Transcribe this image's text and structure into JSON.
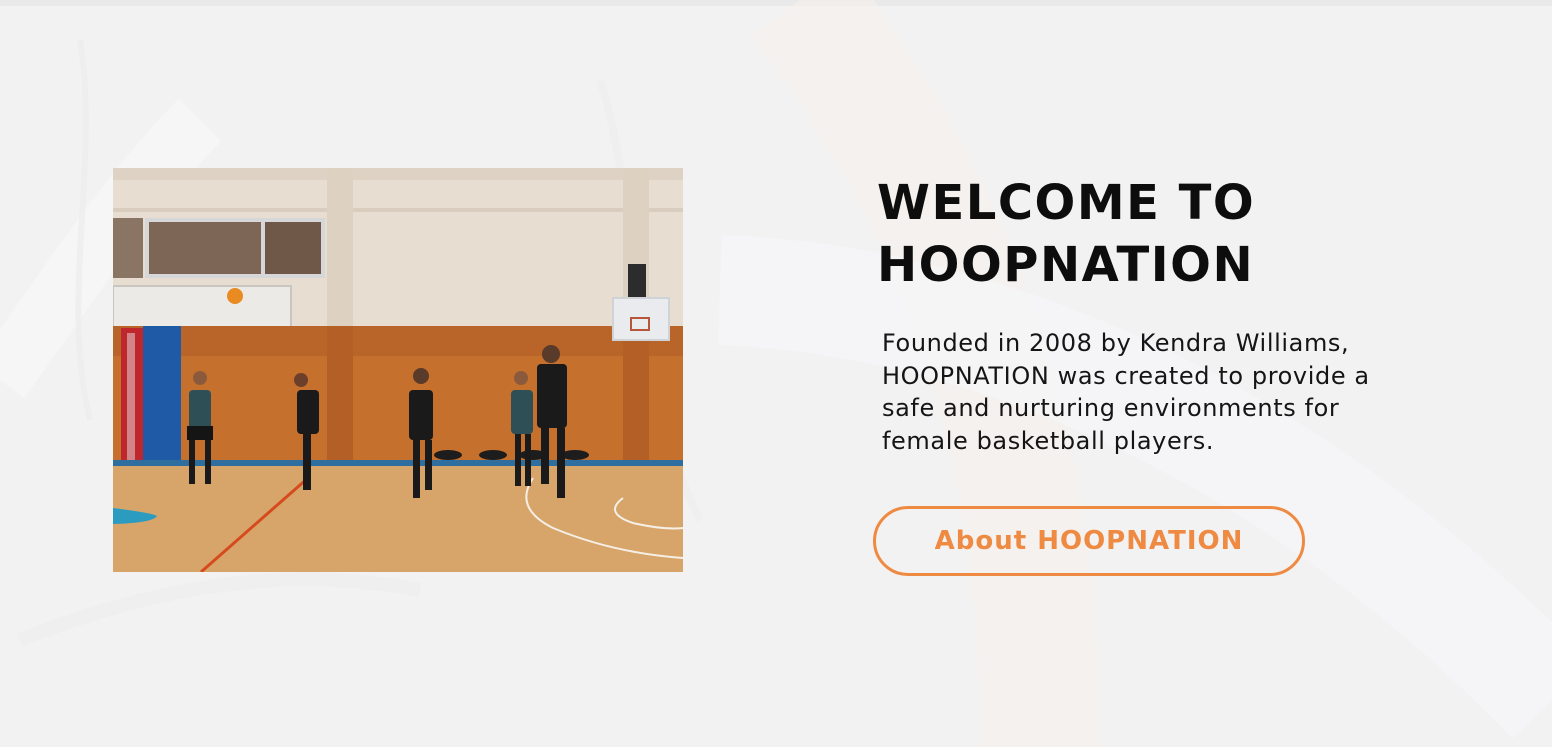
{
  "hero": {
    "headline_lines": [
      "WELCOME TO",
      "HOOPNATION"
    ],
    "description_lines": [
      "Founded in 2008 by Kendra Williams,",
      "HOOPNATION was created to provide a",
      "safe and nurturing environments for",
      "female basketball players."
    ],
    "cta_label": "About HOOPNATION"
  },
  "colors": {
    "background": "#f2f2f3",
    "accent": "#ee8a42",
    "headline": "#0d0d0d",
    "body_text": "#151515"
  }
}
